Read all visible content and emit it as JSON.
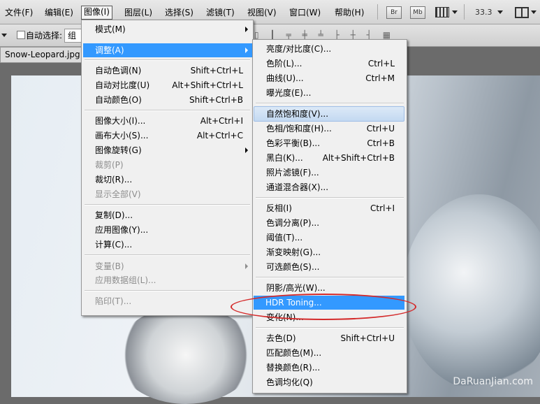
{
  "menubar": {
    "items": [
      "文件(F)",
      "编辑(E)",
      "图像(I)",
      "图层(L)",
      "选择(S)",
      "滤镜(T)",
      "视图(V)",
      "窗口(W)",
      "帮助(H)"
    ],
    "badge_br": "Br",
    "badge_mb": "Mb",
    "zoom": "33.3"
  },
  "options": {
    "auto_select_label": "自动选择:",
    "auto_select_value": "组"
  },
  "document": {
    "tab_title": "Snow-Leopard.jpg @"
  },
  "image_menu": {
    "items": [
      {
        "label": "模式(M)",
        "shortcut": "",
        "submenu": true,
        "disabled": false
      },
      {
        "label": "调整(A)",
        "shortcut": "",
        "submenu": true,
        "disabled": false,
        "active": true
      },
      {
        "label": "自动色调(N)",
        "shortcut": "Shift+Ctrl+L"
      },
      {
        "label": "自动对比度(U)",
        "shortcut": "Alt+Shift+Ctrl+L"
      },
      {
        "label": "自动颜色(O)",
        "shortcut": "Shift+Ctrl+B"
      },
      {
        "label": "图像大小(I)...",
        "shortcut": "Alt+Ctrl+I"
      },
      {
        "label": "画布大小(S)...",
        "shortcut": "Alt+Ctrl+C"
      },
      {
        "label": "图像旋转(G)",
        "shortcut": "",
        "submenu": true
      },
      {
        "label": "裁剪(P)",
        "shortcut": "",
        "disabled": true
      },
      {
        "label": "裁切(R)...",
        "shortcut": ""
      },
      {
        "label": "显示全部(V)",
        "shortcut": "",
        "disabled": true
      },
      {
        "label": "复制(D)...",
        "shortcut": ""
      },
      {
        "label": "应用图像(Y)...",
        "shortcut": ""
      },
      {
        "label": "计算(C)...",
        "shortcut": ""
      },
      {
        "label": "变量(B)",
        "shortcut": "",
        "submenu": true,
        "disabled": true
      },
      {
        "label": "应用数据组(L)...",
        "shortcut": "",
        "disabled": true
      },
      {
        "label": "陷印(T)...",
        "shortcut": "",
        "disabled": true
      }
    ]
  },
  "adjust_menu": {
    "items": [
      {
        "label": "亮度/对比度(C)...",
        "shortcut": ""
      },
      {
        "label": "色阶(L)...",
        "shortcut": "Ctrl+L"
      },
      {
        "label": "曲线(U)...",
        "shortcut": "Ctrl+M"
      },
      {
        "label": "曝光度(E)...",
        "shortcut": ""
      },
      {
        "label": "自然饱和度(V)...",
        "shortcut": ""
      },
      {
        "label": "色相/饱和度(H)...",
        "shortcut": "Ctrl+U"
      },
      {
        "label": "色彩平衡(B)...",
        "shortcut": "Ctrl+B"
      },
      {
        "label": "黑白(K)...",
        "shortcut": "Alt+Shift+Ctrl+B"
      },
      {
        "label": "照片滤镜(F)...",
        "shortcut": ""
      },
      {
        "label": "通道混合器(X)...",
        "shortcut": ""
      },
      {
        "label": "反相(I)",
        "shortcut": "Ctrl+I"
      },
      {
        "label": "色调分离(P)...",
        "shortcut": ""
      },
      {
        "label": "阈值(T)...",
        "shortcut": ""
      },
      {
        "label": "渐变映射(G)...",
        "shortcut": ""
      },
      {
        "label": "可选颜色(S)...",
        "shortcut": ""
      },
      {
        "label": "阴影/高光(W)...",
        "shortcut": ""
      },
      {
        "label": "HDR Toning...",
        "shortcut": ""
      },
      {
        "label": "变化(N)...",
        "shortcut": ""
      },
      {
        "label": "去色(D)",
        "shortcut": "Shift+Ctrl+U"
      },
      {
        "label": "匹配颜色(M)...",
        "shortcut": ""
      },
      {
        "label": "替换颜色(R)...",
        "shortcut": ""
      },
      {
        "label": "色调均化(Q)",
        "shortcut": ""
      }
    ]
  },
  "watermark": "DaRuanJian.com",
  "colors": {
    "highlight": "#3399ff",
    "annotation": "#d42a2a"
  }
}
